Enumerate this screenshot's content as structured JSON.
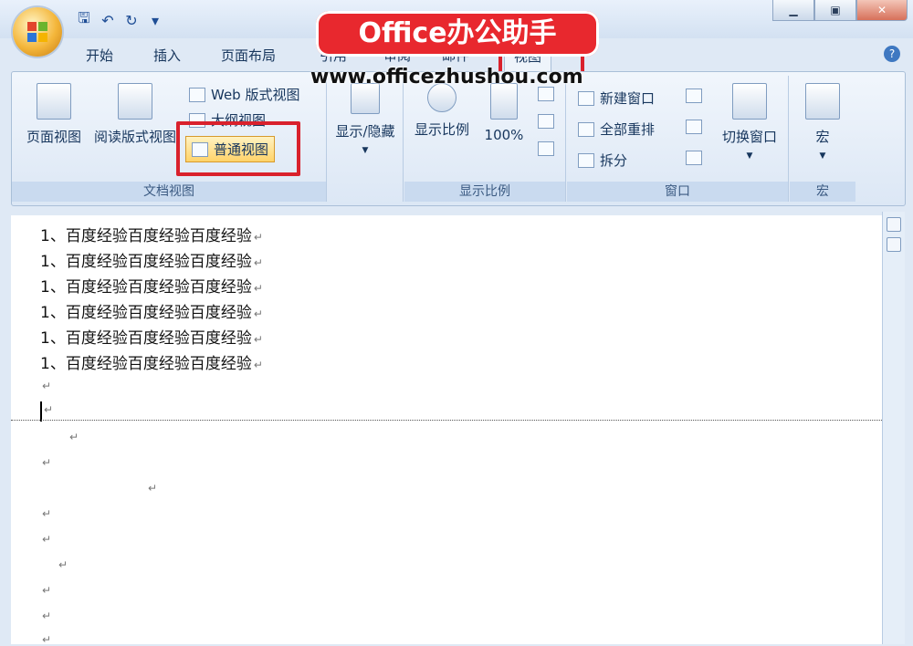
{
  "quick_access": {
    "icons": [
      "save-icon",
      "undo-icon",
      "redo-icon",
      "customize-icon"
    ]
  },
  "tabs": [
    {
      "label": "开始"
    },
    {
      "label": "插入"
    },
    {
      "label": "页面布局"
    },
    {
      "label": "引用"
    },
    {
      "label": "审阅"
    },
    {
      "label": "邮件"
    },
    {
      "label": "视图",
      "active": true
    }
  ],
  "ribbon": {
    "doc_view": {
      "label": "文档视图",
      "page_view": "页面视图",
      "reading_view": "阅读版式视图",
      "web_view": "Web 版式视图",
      "outline_view": "大纲视图",
      "normal_view": "普通视图"
    },
    "show_hide": {
      "label": "显示/隐藏"
    },
    "zoom": {
      "label": "显示比例",
      "zoom_btn": "显示比例",
      "percent": "100%"
    },
    "window": {
      "label": "窗口",
      "new_window": "新建窗口",
      "arrange_all": "全部重排",
      "split": "拆分",
      "switch_window": "切换窗口"
    },
    "macro": {
      "label": "宏",
      "macro_btn": "宏"
    }
  },
  "document": {
    "lines": [
      "1、百度经验百度经验百度经验",
      "1、百度经验百度经验百度经验",
      "1、百度经验百度经验百度经验",
      "1、百度经验百度经验百度经验",
      "1、百度经验百度经验百度经验",
      "1、百度经验百度经验百度经验"
    ],
    "paragraph_mark": "↵"
  },
  "overlay": {
    "watermark": "Office办公助手",
    "url": "www.officezhushou.com"
  },
  "colors": {
    "highlight": "#d9212c",
    "watermark_bg": "#e8282e",
    "active_button": "#ffd369"
  }
}
